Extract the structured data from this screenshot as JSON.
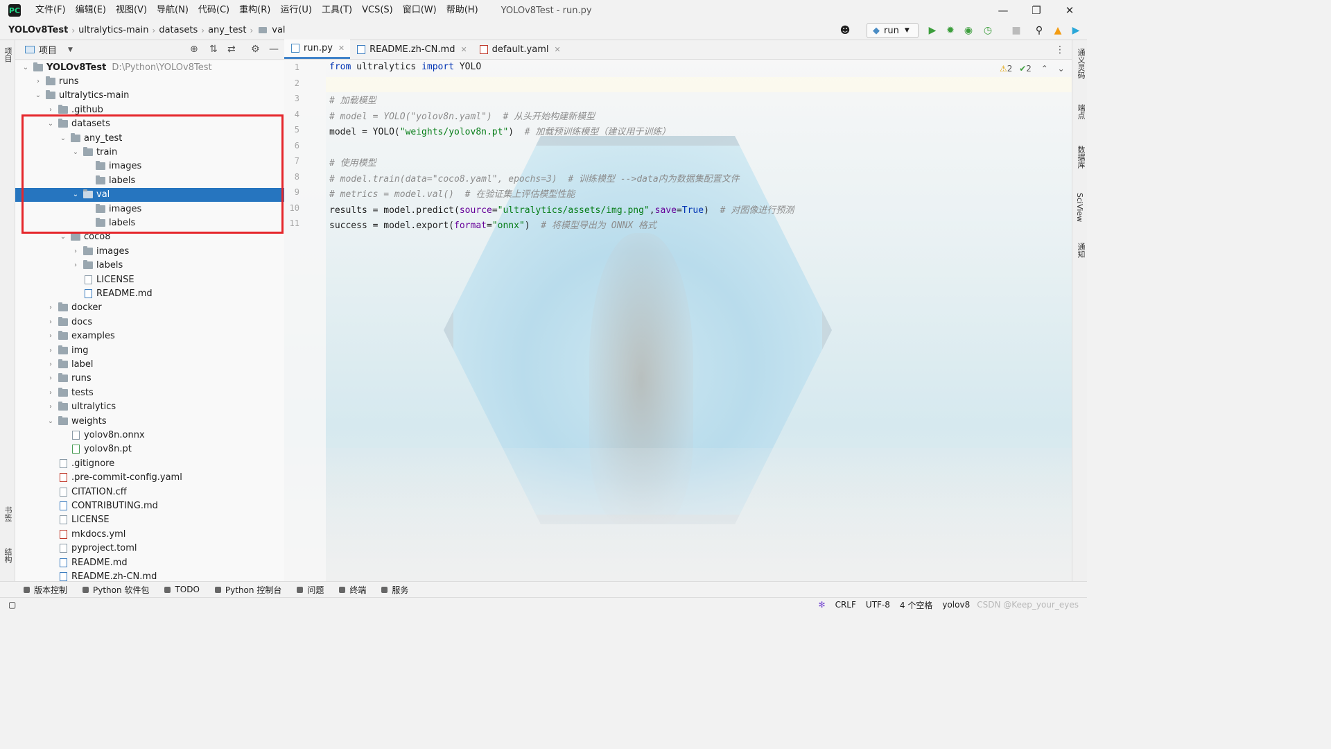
{
  "menubar": {
    "items": [
      "文件(F)",
      "编辑(E)",
      "视图(V)",
      "导航(N)",
      "代码(C)",
      "重构(R)",
      "运行(U)",
      "工具(T)",
      "VCS(S)",
      "窗口(W)",
      "帮助(H)"
    ],
    "window_title": "YOLOv8Test - run.py"
  },
  "breadcrumb": [
    "YOLOv8Test",
    "ultralytics-main",
    "datasets",
    "any_test",
    "val"
  ],
  "toolbar": {
    "run_config": "run"
  },
  "project_panel": {
    "title": "项目",
    "root_name": "YOLOv8Test",
    "root_path": "D:\\Python\\YOLOv8Test",
    "rows": [
      {
        "label": "runs"
      },
      {
        "label": "ultralytics-main"
      },
      {
        "label": ".github"
      },
      {
        "label": "datasets"
      },
      {
        "label": "any_test"
      },
      {
        "label": "train"
      },
      {
        "label": "images"
      },
      {
        "label": "labels"
      },
      {
        "label": "val"
      },
      {
        "label": "images"
      },
      {
        "label": "labels"
      },
      {
        "label": "coco8"
      },
      {
        "label": "images"
      },
      {
        "label": "labels"
      },
      {
        "label": "LICENSE"
      },
      {
        "label": "README.md"
      },
      {
        "label": "docker"
      },
      {
        "label": "docs"
      },
      {
        "label": "examples"
      },
      {
        "label": "img"
      },
      {
        "label": "label"
      },
      {
        "label": "runs"
      },
      {
        "label": "tests"
      },
      {
        "label": "ultralytics"
      },
      {
        "label": "weights"
      },
      {
        "label": "yolov8n.onnx"
      },
      {
        "label": "yolov8n.pt"
      },
      {
        "label": ".gitignore"
      },
      {
        "label": ".pre-commit-config.yaml"
      },
      {
        "label": "CITATION.cff"
      },
      {
        "label": "CONTRIBUTING.md"
      },
      {
        "label": "LICENSE"
      },
      {
        "label": "mkdocs.yml"
      },
      {
        "label": "pyproject.toml"
      },
      {
        "label": "README.md"
      },
      {
        "label": "README.zh-CN.md"
      }
    ]
  },
  "left_strip": {
    "project": "项目",
    "bookmarks": "书签",
    "structure": "结构"
  },
  "right_strip": {
    "notifications_top": "通义灵码",
    "endpoints": "端点",
    "database": "数据库",
    "sciview": "SciView",
    "notifications": "通知"
  },
  "editor": {
    "tabs": [
      "run.py",
      "README.zh-CN.md",
      "default.yaml"
    ],
    "inspection_warn": "2",
    "inspection_ok": "2",
    "line_numbers": [
      "1",
      "2",
      "3",
      "4",
      "5",
      "6",
      "7",
      "8",
      "9",
      "10",
      "11"
    ],
    "lines": {
      "l1_kw1": "from",
      "l1_mid": " ultralytics ",
      "l1_kw2": "import",
      "l1_end": " YOLO",
      "l3": "# 加载模型",
      "l4": "# model = YOLO(\"yolov8n.yaml\")  # 从头开始构建新模型",
      "l5_code": "model = YOLO(",
      "l5_str": "\"weights/yolov8n.pt\"",
      "l5_end": ")  ",
      "l5_cm": "# 加载预训练模型（建议用于训练）",
      "l7": "# 使用模型",
      "l8": "# model.train(data=\"coco8.yaml\", epochs=3)  # 训练模型 -->data内为数据集配置文件",
      "l9": "# metrics = model.val()  # 在验证集上评估模型性能",
      "l10_code": "results = model.predict(",
      "l10_p1": "source",
      "l10_eq1": "=",
      "l10_str": "\"ultralytics/assets/img.png\"",
      "l10_comma": ",",
      "l10_p2": "save",
      "l10_eq2": "=",
      "l10_kw": "True",
      "l10_end": ")  ",
      "l10_cm": "# 对图像进行预测",
      "l11_code": "success = model.export(",
      "l11_p": "format",
      "l11_eq": "=",
      "l11_str": "\"onnx\"",
      "l11_end": ")  ",
      "l11_cm": "# 将模型导出为 ONNX 格式"
    }
  },
  "tool_windows": [
    "版本控制",
    "Python 软件包",
    "TODO",
    "Python 控制台",
    "问题",
    "终端",
    "服务"
  ],
  "status": {
    "line_sep": "CRLF",
    "encoding": "UTF-8",
    "indent": "4 个空格",
    "interpreter": "yolov8",
    "watermark": "CSDN @Keep_your_eyes"
  },
  "colors": {
    "selection": "#2675bf",
    "highlight_box": "#e5262b",
    "keyword": "#0033b3",
    "string": "#067d17",
    "comment": "#8c8c8c"
  }
}
